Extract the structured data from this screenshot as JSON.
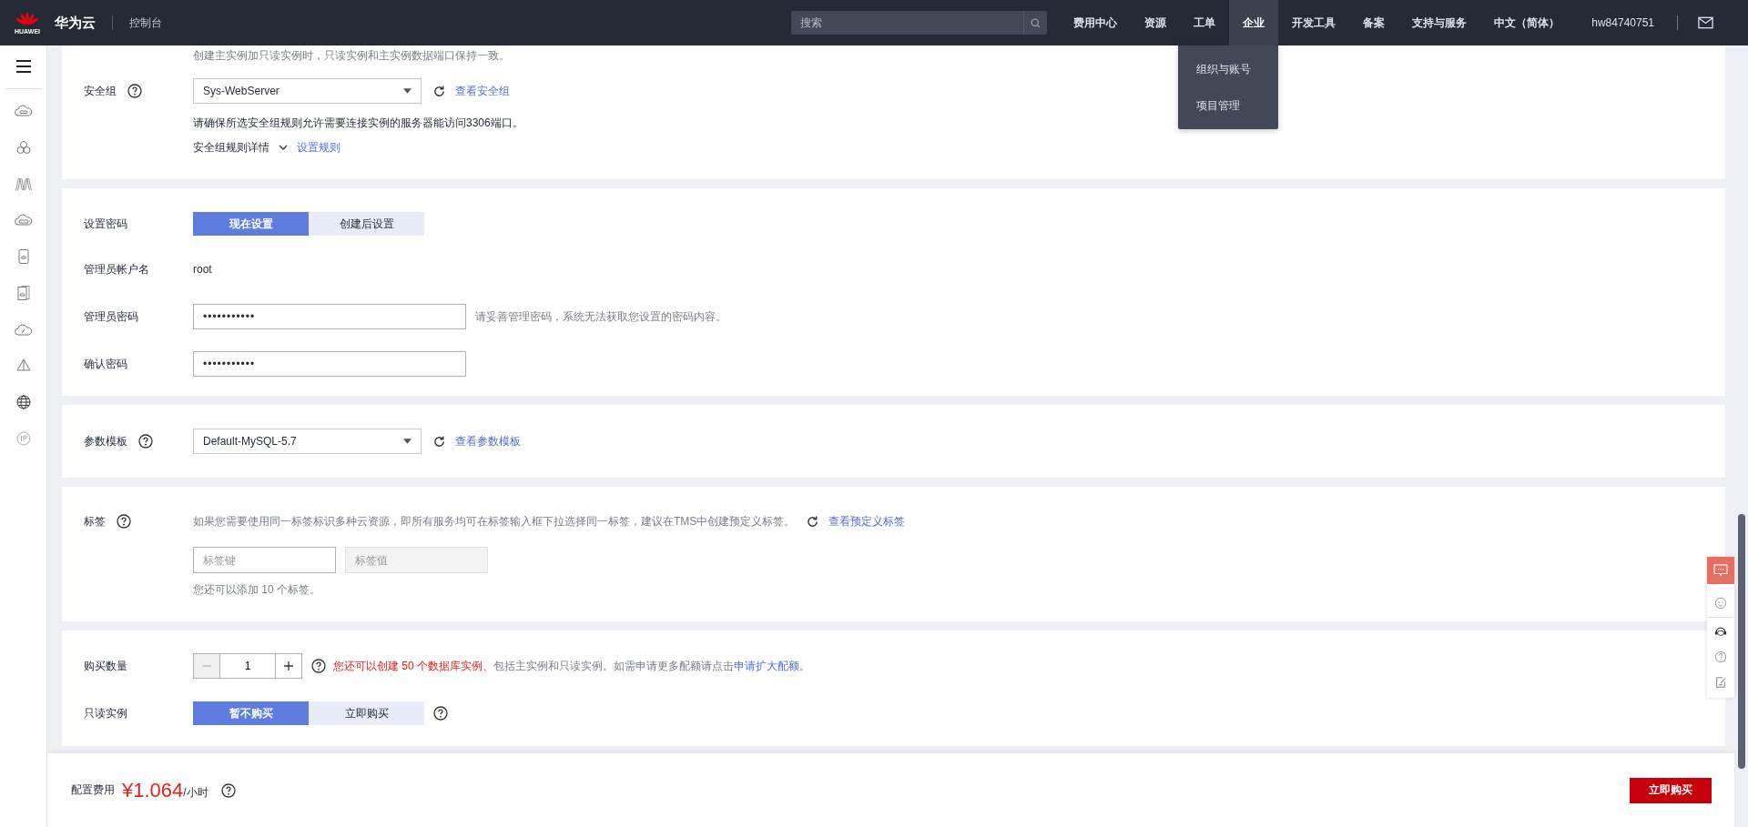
{
  "topbar": {
    "logo_text": "HUAWEI",
    "brand": "华为云",
    "console": "控制台",
    "search": {
      "placeholder": "搜索"
    },
    "nav": [
      {
        "label": "费用中心",
        "selected": false
      },
      {
        "label": "资源",
        "selected": false
      },
      {
        "label": "工单",
        "selected": false
      },
      {
        "label": "企业",
        "selected": true
      },
      {
        "label": "开发工具",
        "selected": false
      },
      {
        "label": "备案",
        "selected": false
      },
      {
        "label": "支持与服务",
        "selected": false
      },
      {
        "label": "中文（简体）",
        "selected": false
      }
    ],
    "user": "hw84740751",
    "dropdown": [
      "组织与账号",
      "项目管理"
    ]
  },
  "security": {
    "hint": "创建主实例加只读实例时，只读实例和主实例数据端口保持一致。",
    "label": "安全组",
    "value": "Sys-WebServer",
    "link": "查看安全组",
    "note": "请确保所选安全组规则允许需要连接实例的服务器能访问3306端口。",
    "details": "安全组规则详情",
    "details_link": "设置规则"
  },
  "password": {
    "label": "设置密码",
    "options": [
      {
        "label": "现在设置",
        "selected": true
      },
      {
        "label": "创建后设置",
        "selected": false
      }
    ],
    "admin_label": "管理员帐户名",
    "admin_value": "root",
    "pwd_label": "管理员密码",
    "pwd_value": "•••••••••••",
    "pwd_hint": "请妥善管理密码，系统无法获取您设置的密码内容。",
    "confirm_label": "确认密码",
    "confirm_value": "•••••••••••"
  },
  "param": {
    "label": "参数模板",
    "value": "Default-MySQL-5.7",
    "link": "查看参数模板"
  },
  "tags": {
    "label": "标签",
    "hint": "如果您需要使用同一标签标识多种云资源，即所有服务均可在标签输入框下拉选择同一标签，建议在TMS中创建预定义标签。",
    "link": "查看预定义标签",
    "key_placeholder": "标签键",
    "value_placeholder": "标签值",
    "value_disabled": true,
    "note": "您还可以添加 10 个标签。"
  },
  "purchase": {
    "qty_label": "购买数量",
    "quantity": "1",
    "minus_disabled": true,
    "quota_warning": "您还可以创建 50 个数据库实例、",
    "quota_text": "包括主实例和只读实例。如需申请更多配额请点击",
    "quota_link": "申请扩大配额",
    "quota_end": "。",
    "readonly_label": "只读实例",
    "options": [
      {
        "label": "暂不购买",
        "selected": true
      },
      {
        "label": "立即购买",
        "selected": false
      }
    ]
  },
  "footer": {
    "label": "配置费用",
    "price": "¥1.064",
    "unit": "/小时",
    "buy": "立即购买"
  }
}
